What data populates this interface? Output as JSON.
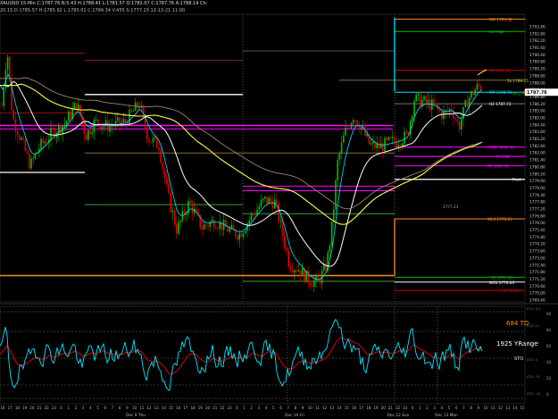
{
  "header": {
    "line1": "XAUUSD 15-Min  C:1787.76  N:5.43  H:1788.41  L:1781.57  O:1782.07  C:1787.76  A:1788.14  Ch:",
    "line2": "20.15  D:1785.57  H:1785.92  L:1783.01  C:1784.34  V:455  S:1777.23  12-13-21  11:00"
  },
  "colors": {
    "background": "#000000",
    "candle_up": "#00c000",
    "candle_down": "#e00000",
    "cyan": "#00e5ff",
    "white": "#ffffff",
    "yellow": "#ffff40",
    "magenta": "#ff00ff",
    "orange": "#ff8c1a",
    "green_level": "#00c000",
    "red_level": "#d00000",
    "brown": "#8a6a3a"
  },
  "level_labels": [
    {
      "text": "WR 1793.58",
      "color": "#ff8c1a",
      "price": 1793.58
    },
    {
      "text": "Lst High",
      "color": "#00c000",
      "price": 1792.5
    },
    {
      "text": "R1 1789.11",
      "color": "#d00000",
      "price": 1789.11
    },
    {
      "text": "5k 1788.25",
      "color": "#cccc33",
      "price": 1788.25
    },
    {
      "text": "MR 1788.72",
      "color": "#00e5ff",
      "price": 1787.2
    },
    {
      "text": "H=1788.98",
      "color": "#00c000",
      "price": 1787.1
    },
    {
      "text": "H2 1787.73",
      "color": "#ffffff",
      "price": 1786.2
    },
    {
      "text": "RRNR 1782.41",
      "color": "#ff00ff",
      "price": 1782.41
    },
    {
      "text": "P-1782",
      "color": "#ff00ff",
      "price": 1781.6
    },
    {
      "text": "PP 1780.78",
      "color": "#ff00ff",
      "price": 1780.78
    },
    {
      "text": "Pvot",
      "color": "#ffffff",
      "price": 1779.6
    },
    {
      "text": "1777.23",
      "color": "#aaaaaa",
      "price": 1777.23
    },
    {
      "text": "WL3 1776.15",
      "color": "#ff8c1a",
      "price": 1776.15
    },
    {
      "text": "S1 1771.06",
      "color": "#00c000",
      "price": 1771.06
    },
    {
      "text": "WS1 1770.63",
      "color": "#ffffff",
      "price": 1770.63
    },
    {
      "text": "L 1770.00",
      "color": "#d00000",
      "price": 1769.9
    }
  ],
  "price_axis": {
    "ticks": [
      "1793.40",
      "1792.80",
      "1792.20",
      "1791.60",
      "1790.40",
      "1789.80",
      "1789.20",
      "1788.60",
      "1788.00",
      "1787.40",
      "1786.80",
      "1786.20",
      "1785.60",
      "1785.00",
      "1784.40",
      "1783.80",
      "1783.20",
      "1782.60",
      "1782.00",
      "1781.40",
      "1780.80",
      "1780.20",
      "1779.60",
      "1779.00",
      "1778.40",
      "1777.80",
      "1777.20",
      "1776.60",
      "1776.00",
      "1775.40",
      "1774.80",
      "1774.20",
      "1773.60",
      "1773.00",
      "1772.40",
      "1771.80",
      "1771.20",
      "1770.60",
      "1770.00",
      "1769.40"
    ],
    "current": "1787.76"
  },
  "indicator": {
    "label_td": "684 TD",
    "label_yrange": "1925 YRange",
    "sto_label": "STO",
    "sto_levels": [
      "STO: 9.0",
      "STO: 15",
      "STO: 20",
      "STO: 0",
      "STO: 10",
      "STO: -15"
    ],
    "axis": [
      "96",
      "80",
      "60",
      "40",
      "20",
      "0"
    ]
  },
  "time_axis": {
    "hours": [
      "16",
      "17",
      "18",
      "19",
      "20",
      "21",
      "22",
      "23",
      "0",
      "1",
      "2",
      "3",
      "4",
      "5",
      "6",
      "7",
      "8",
      "9",
      "10",
      "11",
      "12",
      "13",
      "14",
      "15",
      "16",
      "17",
      "18",
      "19",
      "20",
      "21",
      "22",
      "23",
      "0",
      "1",
      "2",
      "3",
      "4",
      "5",
      "6",
      "7",
      "8",
      "9",
      "10",
      "11",
      "12",
      "13",
      "14",
      "15",
      "16",
      "17",
      "18",
      "19",
      "20",
      "21",
      "22",
      "23",
      "0",
      "1",
      "2",
      "3",
      "4",
      "5",
      "6",
      "7",
      "8",
      "9",
      "10",
      "11",
      "12",
      "13",
      "14",
      "15"
    ],
    "days": [
      "Dec 9 Thu",
      "Dec 10 Fri",
      "Dec 12 Sun",
      "Dec 13 Mon"
    ]
  }
}
